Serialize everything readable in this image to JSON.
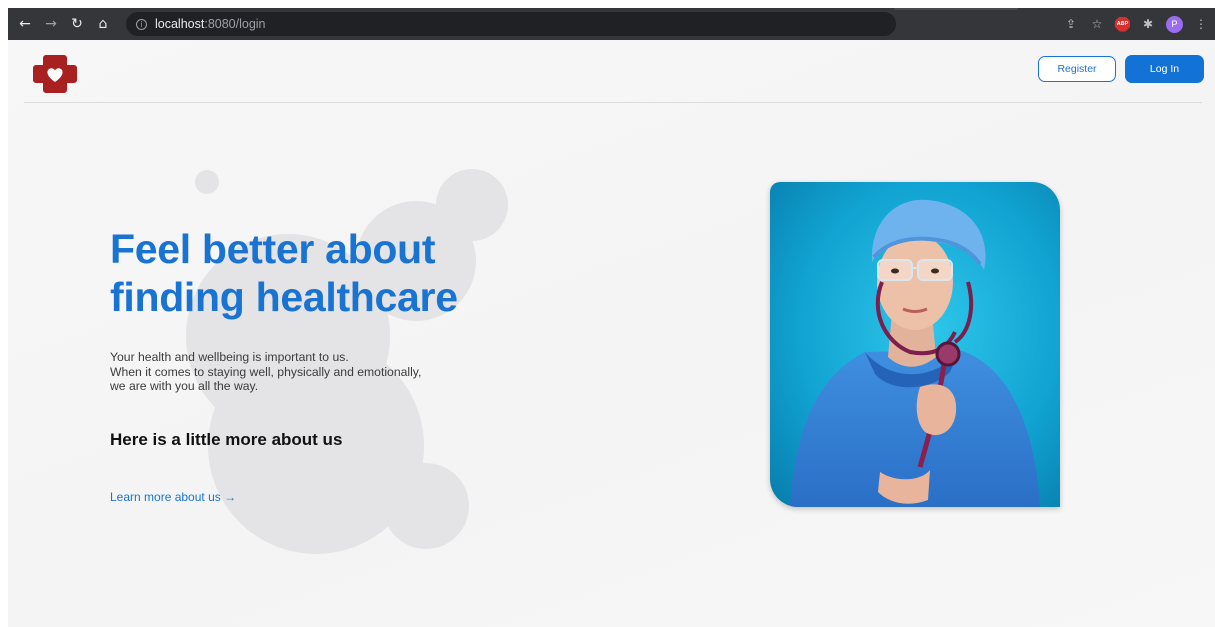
{
  "browser": {
    "url_host": "localhost",
    "url_path": ":8080/login",
    "back_icon": "arrow-left-icon",
    "forward_icon": "arrow-right-icon",
    "reload_icon": "reload-icon",
    "home_icon": "home-icon",
    "abp_label": "ABP",
    "profile_initial": "P"
  },
  "header": {
    "register_label": "Register",
    "login_label": "Log In",
    "brand_color": "#1272d6",
    "logo_color": "#a8201f"
  },
  "hero": {
    "title": "Feel better about finding healthcare",
    "text_lines": [
      "Your health and wellbeing is important to us.",
      "When it comes to staying well, physically and emotionally,",
      "we are with you all the way."
    ],
    "subtitle": "Here is a little more about us",
    "link_label": "Learn more about us →"
  }
}
